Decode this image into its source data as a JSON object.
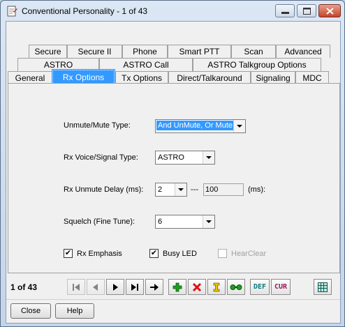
{
  "window": {
    "title": "Conventional Personality - 1 of 43"
  },
  "tabs": {
    "row1": [
      "Secure",
      "Secure II",
      "Phone",
      "Smart PTT",
      "Scan",
      "Advanced"
    ],
    "row2": [
      "ASTRO",
      "ASTRO Call",
      "ASTRO Talkgroup Options"
    ],
    "row3": [
      "General",
      "Rx Options",
      "Tx Options",
      "Direct/Talkaround",
      "Signaling",
      "MDC"
    ],
    "active": "Rx Options"
  },
  "form": {
    "unmute_label": "Unmute/Mute Type:",
    "unmute_value": "And UnMute, Or Mute",
    "rx_voice_label": "Rx Voice/Signal Type:",
    "rx_voice_value": "ASTRO",
    "rx_delay_label": "Rx Unmute Delay (ms):",
    "rx_delay_value": "2",
    "rx_delay_dash": "---",
    "rx_delay_ms_value": "100",
    "rx_delay_ms_unit": "(ms):",
    "squelch_label": "Squelch (Fine Tune):",
    "squelch_value": "6",
    "rx_emphasis_label": "Rx Emphasis",
    "rx_emphasis_checked": true,
    "busy_led_label": "Busy LED",
    "busy_led_checked": true,
    "hearclear_label": "HearClear",
    "hearclear_checked": false
  },
  "navigator": {
    "count": "1 of 43",
    "icons": [
      "first-record-icon",
      "previous-record-icon",
      "next-record-icon",
      "last-record-icon",
      "goto-icon",
      "add-icon",
      "delete-icon",
      "insert-icon",
      "copy-icon",
      "default-icon",
      "current-icon",
      "grid-icon"
    ],
    "def_label": "DEF",
    "cur_label": "CUR"
  },
  "buttons": {
    "close_label": "Close",
    "help_label": "Help"
  },
  "colors": {
    "selection": "#3399ff",
    "add_green": "#1e9e1e",
    "delete_red": "#e01010",
    "insert_yellow": "#e8c400"
  }
}
